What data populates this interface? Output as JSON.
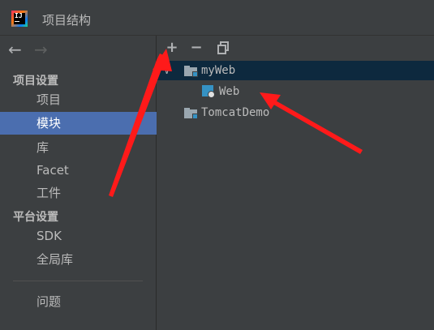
{
  "window": {
    "title": "项目结构"
  },
  "nav": {
    "back_icon": "arrow-left-icon",
    "forward_icon": "arrow-right-icon"
  },
  "sidebar": {
    "project_settings_header": "项目设置",
    "project_items": [
      {
        "label": "项目",
        "selected": false
      },
      {
        "label": "模块",
        "selected": true
      },
      {
        "label": "库",
        "selected": false
      },
      {
        "label": "Facet",
        "selected": false
      },
      {
        "label": "工件",
        "selected": false
      }
    ],
    "platform_settings_header": "平台设置",
    "platform_items": [
      {
        "label": "SDK"
      },
      {
        "label": "全局库"
      }
    ],
    "problems_label": "问题"
  },
  "toolbar": {
    "add_symbol": "+",
    "remove_symbol": "−",
    "copy_icon": "copy-icon"
  },
  "tree": {
    "nodes": [
      {
        "label": "myWeb",
        "expanded": true,
        "selected": true,
        "icon": "module-folder-icon"
      },
      {
        "label": "Web",
        "icon": "web-facet-icon",
        "parent": "myWeb"
      },
      {
        "label": "TomcatDemo",
        "icon": "module-folder-icon"
      }
    ]
  },
  "colors": {
    "selection": "#4b6eaf",
    "tree_selection": "#0d293e",
    "annotation_arrow": "#ff1a1a"
  }
}
